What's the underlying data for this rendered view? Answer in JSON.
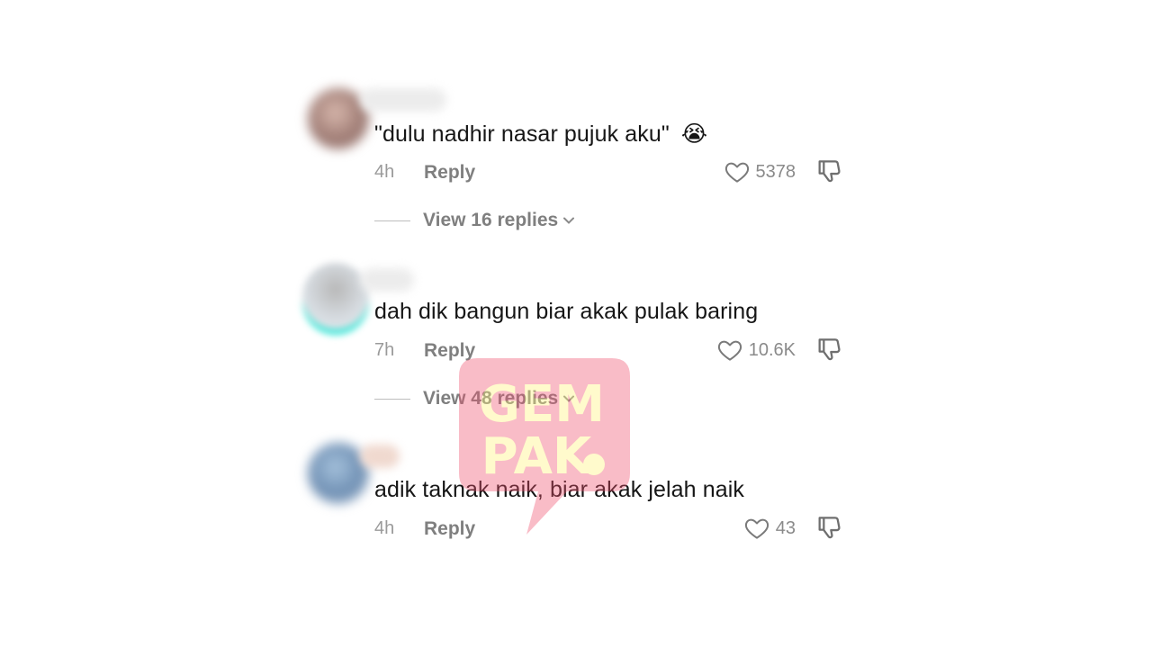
{
  "comments": [
    {
      "text": "\"dulu nadhir nasar pujuk aku\"",
      "emoji": "😭",
      "time": "4h",
      "reply_label": "Reply",
      "likes": "5378",
      "view_replies": "View 16 replies"
    },
    {
      "text": "dah dik bangun biar akak pulak baring",
      "time": "7h",
      "reply_label": "Reply",
      "likes": "10.6K",
      "view_replies": "View 48 replies"
    },
    {
      "text": "adik taknak naik, biar akak jelah naik",
      "time": "4h",
      "reply_label": "Reply",
      "likes": "43"
    }
  ],
  "watermark": {
    "line1": "GEM",
    "line2": "PAK",
    "color": "#f0506e",
    "text_color": "#fff27a"
  },
  "colors": {
    "text": "#161616",
    "meta": "#9a9a9a",
    "action": "#7f7f7f",
    "avatar_ring": "#2ee6d6"
  }
}
